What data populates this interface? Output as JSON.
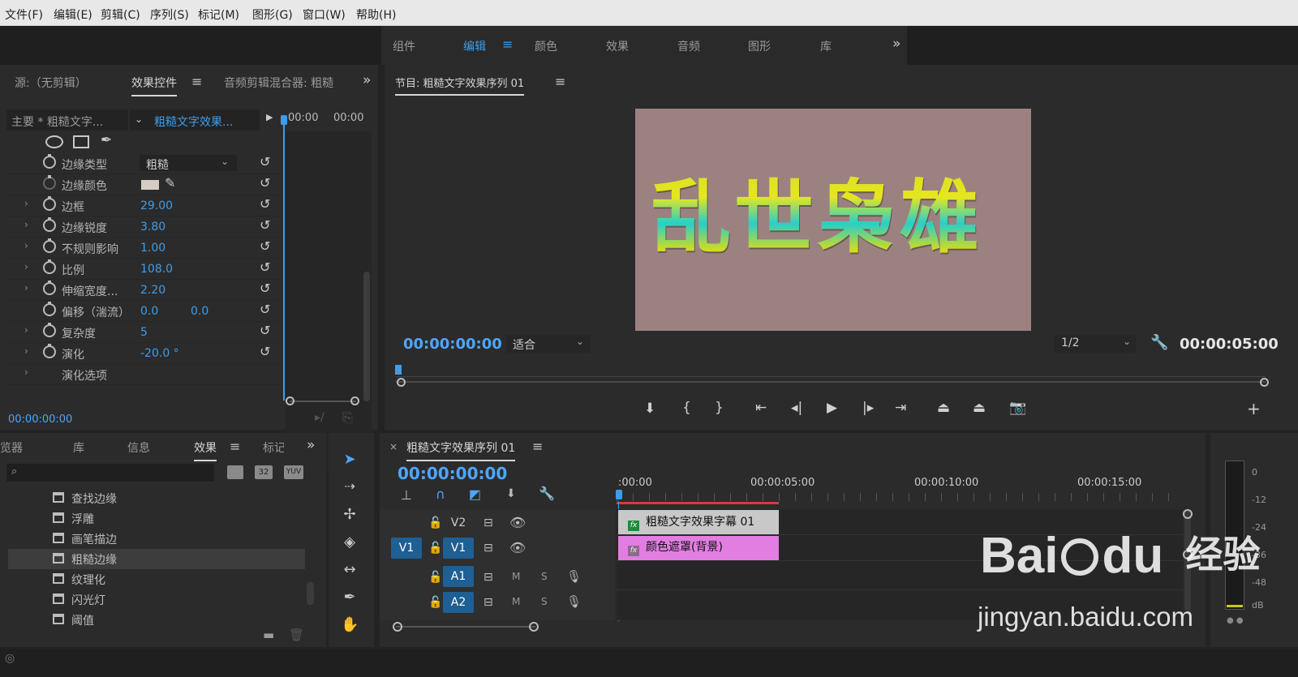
{
  "menubar": {
    "items": [
      "文件(F)",
      "编辑(E)",
      "剪辑(C)",
      "序列(S)",
      "标记(M)",
      "图形(G)",
      "窗口(W)",
      "帮助(H)"
    ]
  },
  "workspaces": {
    "items": [
      "组件",
      "编辑",
      "颜色",
      "效果",
      "音频",
      "图形",
      "库"
    ],
    "active": "编辑",
    "overflow": "»"
  },
  "source_panel": {
    "tabs": [
      "源:（无剪辑）",
      "效果控件",
      "音频剪辑混合器: 粗糙"
    ],
    "master": "主要 * 粗糙文字...",
    "clip": "粗糙文字效果...",
    "ruler": [
      "00:00",
      "00:00"
    ],
    "params": [
      {
        "label": "边缘类型",
        "dropdown": "粗糙"
      },
      {
        "label": "边缘颜色"
      },
      {
        "label": "边框",
        "value": "29.00"
      },
      {
        "label": "边缘锐度",
        "value": "3.80"
      },
      {
        "label": "不规则影响",
        "value": "1.00"
      },
      {
        "label": "比例",
        "value": "108.0"
      },
      {
        "label": "伸缩宽度...",
        "value": "2.20"
      },
      {
        "label": "偏移（湍流）",
        "value": "0.0",
        "value2": "0.0"
      },
      {
        "label": "复杂度",
        "value": "5"
      },
      {
        "label": "演化",
        "value": "-20.0 °"
      },
      {
        "label": "演化选项"
      }
    ],
    "timecode": "00:00:00:00"
  },
  "program": {
    "title": "节目: 粗糙文字效果序列 01",
    "preview_text": "乱世枭雄",
    "timecode": "00:00:00:00",
    "fit": "适合",
    "resolution": "1/2",
    "duration": "00:00:05:00",
    "colors": {
      "bg": "#9b8280",
      "text_top": "#dede1e",
      "text_mid": "#2ad2c8"
    }
  },
  "effects_panel": {
    "tabs": [
      "览器",
      "库",
      "信息",
      "效果",
      "标记"
    ],
    "badges": [
      "32",
      "YUV"
    ],
    "items": [
      "查找边缘",
      "浮雕",
      "画笔描边",
      "粗糙边缘",
      "纹理化",
      "闪光灯",
      "阈值"
    ],
    "selected": "粗糙边缘"
  },
  "timeline": {
    "close": "×",
    "title": "粗糙文字效果序列 01",
    "timecode": "00:00:00:00",
    "ruler": [
      ":00:00",
      "00:00:05:00",
      "00:00:10:00",
      "00:00:15:00"
    ],
    "tracks": {
      "v2": "V2",
      "v1_src": "V1",
      "v1": "V1",
      "a1": "A1",
      "a2": "A2",
      "m": "M",
      "s": "S"
    },
    "clips": [
      {
        "name": "粗糙文字效果字幕 01",
        "color": "#c8c8c8"
      },
      {
        "name": "颜色遮罩(背景)",
        "color": "#e27de2"
      }
    ],
    "fx": "fx"
  },
  "audio_meter": {
    "scale": [
      "0",
      "-12",
      "-24",
      "-36",
      "-48",
      "dB"
    ]
  },
  "watermark": {
    "brand": "Bai",
    "brand2": "du",
    "cn": "经验",
    "url": "jingyan.baidu.com"
  }
}
